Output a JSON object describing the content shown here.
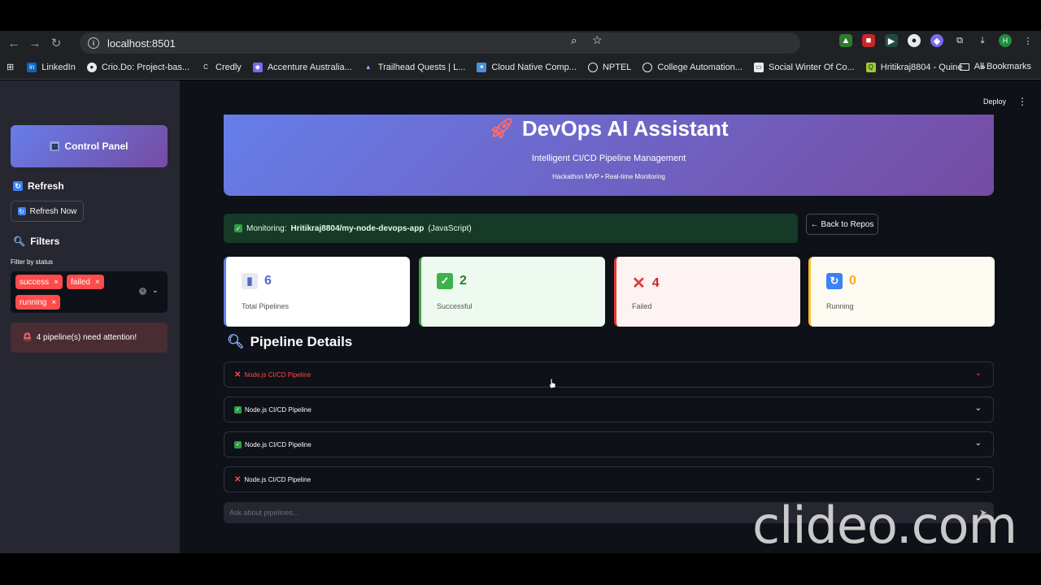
{
  "browser": {
    "url": "localhost:8501",
    "bookmarks": [
      "LinkedIn",
      "Crio.Do: Project-bas...",
      "Credly",
      "Accenture Australia...",
      "Trailhead Quests | L...",
      "Cloud Native Comp...",
      "NPTEL",
      "College Automation...",
      "Social Winter Of Co...",
      "Hritikraj8804 - Quine"
    ],
    "all_bookmarks": "All Bookmarks",
    "profile_initial": "H"
  },
  "header": {
    "deploy": "Deploy"
  },
  "sidebar": {
    "control_panel": "Control Panel",
    "refresh_heading": "Refresh",
    "refresh_button": "Refresh Now",
    "filters_heading": "Filters",
    "filter_label": "Filter by status",
    "chips": [
      "success",
      "failed",
      "running"
    ],
    "attention": "4 pipeline(s) need attention!"
  },
  "hero": {
    "title": "DevOps AI Assistant",
    "subtitle": "Intelligent CI/CD Pipeline Management",
    "tagline": "Hackathon MVP • Real-time Monitoring"
  },
  "monitor": {
    "prefix": "Monitoring:",
    "repo": "Hritikraj8804/my-node-devops-app",
    "lang": "(JavaScript)",
    "back_button": "← Back to Repos"
  },
  "metrics": [
    {
      "value": "6",
      "label": "Total Pipelines",
      "color": "#5468c4"
    },
    {
      "value": "2",
      "label": "Successful",
      "color": "#2e7d32"
    },
    {
      "value": "4",
      "label": "Failed",
      "color": "#c62828"
    },
    {
      "value": "0",
      "label": "Running",
      "color": "#f9a825"
    }
  ],
  "details": {
    "title": "Pipeline Details",
    "pipelines": [
      {
        "name": "Node.js CI/CD Pipeline",
        "status": "failed"
      },
      {
        "name": "Node.js CI/CD Pipeline",
        "status": "success"
      },
      {
        "name": "Node.js CI/CD Pipeline",
        "status": "success"
      },
      {
        "name": "Node.js CI/CD Pipeline",
        "status": "failed"
      }
    ]
  },
  "chat": {
    "placeholder": "Ask about pipelines..."
  },
  "watermark": "clideo.com",
  "colors": {
    "accent_gradient_start": "#667eea",
    "accent_gradient_end": "#764ba2",
    "danger": "#ff4b4b",
    "success_bg": "#173928"
  }
}
